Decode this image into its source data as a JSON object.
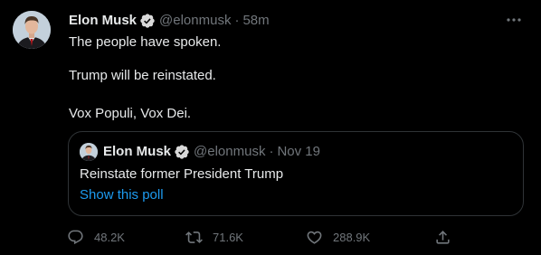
{
  "tweet": {
    "author": {
      "name": "Elon Musk",
      "handle": "@elonmusk",
      "separator": "·",
      "time": "58m"
    },
    "lines": [
      "The people have spoken.",
      "Trump will be reinstated.",
      "Vox Populi, Vox Dei."
    ],
    "quote": {
      "name": "Elon Musk",
      "handle": "@elonmusk",
      "separator": "·",
      "date": "Nov 19",
      "text": "Reinstate former President Trump",
      "link": "Show this poll"
    },
    "actions": {
      "replies": "48.2K",
      "retweets": "71.6K",
      "likes": "288.9K"
    }
  },
  "colors": {
    "background": "#000000",
    "text": "#e7e9ea",
    "muted": "#71767b",
    "link": "#1d9bf0",
    "verified": "#d9d9d9",
    "border": "#2f3336"
  },
  "icons": {
    "verified": "verified-badge-icon",
    "more": "more-horizontal-icon",
    "reply": "reply-icon",
    "retweet": "retweet-icon",
    "like": "heart-icon",
    "share": "share-icon"
  }
}
